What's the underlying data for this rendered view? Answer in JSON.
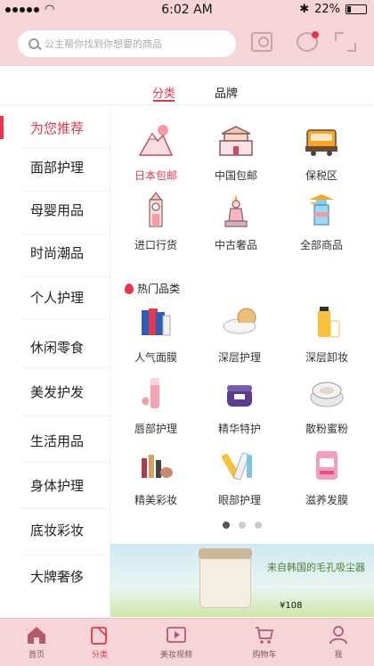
{
  "status": {
    "time": "6:02 AM",
    "battery": "22%"
  },
  "search": {
    "placeholder": "公主帮你找到你想要的商品"
  },
  "tabs": [
    {
      "label": "分类"
    },
    {
      "label": "品牌"
    }
  ],
  "sidebar": {
    "items": [
      {
        "label": "为您推荐"
      },
      {
        "label": "面部护理"
      },
      {
        "label": "母婴用品"
      },
      {
        "label": "时尚潮品"
      },
      {
        "label": "个人护理"
      },
      {
        "label": "休闲零食"
      },
      {
        "label": "美发护发"
      },
      {
        "label": "生活用品"
      },
      {
        "label": "身体护理"
      },
      {
        "label": "底妆彩妆"
      },
      {
        "label": "大牌奢侈"
      }
    ]
  },
  "categories": [
    {
      "label": "日本包邮"
    },
    {
      "label": "中国包邮"
    },
    {
      "label": "保税区"
    },
    {
      "label": "进口行货"
    },
    {
      "label": "中古奢品"
    },
    {
      "label": "全部商品"
    }
  ],
  "hot": {
    "title": "热门品类",
    "items": [
      {
        "label": "人气面膜"
      },
      {
        "label": "深层护理"
      },
      {
        "label": "深层卸妆"
      },
      {
        "label": "唇部护理"
      },
      {
        "label": "精华特护"
      },
      {
        "label": "散粉蜜粉"
      },
      {
        "label": "精美彩妆"
      },
      {
        "label": "眼部护理"
      },
      {
        "label": "滋养发膜"
      }
    ]
  },
  "banner": {
    "text": "来自韩国的毛孔吸尘器",
    "price": "¥108"
  },
  "bottom_nav": [
    {
      "label": "首页"
    },
    {
      "label": "分类"
    },
    {
      "label": "美妆视频"
    },
    {
      "label": "购物车"
    },
    {
      "label": "我"
    }
  ],
  "colors": {
    "accent": "#e9354a",
    "header_bg": "#f6d5d9"
  }
}
